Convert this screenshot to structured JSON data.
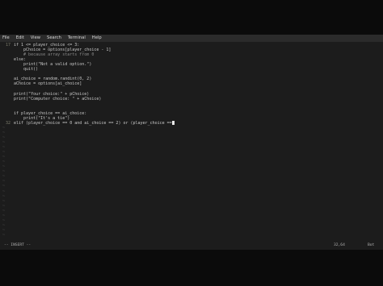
{
  "menubar": {
    "items": [
      "File",
      "Edit",
      "View",
      "Search",
      "Terminal",
      "Help"
    ]
  },
  "editor": {
    "lines": [
      {
        "num": "17",
        "text": "if 1 <= player_choice <= 3:"
      },
      {
        "num": "",
        "text": "    pChoice = options[player_choice - 1]"
      },
      {
        "num": "",
        "text": "    # because array starts from 0"
      },
      {
        "num": "",
        "text": "else:"
      },
      {
        "num": "",
        "text": "    print(\"Not a valid option.\")"
      },
      {
        "num": "",
        "text": "    quit()"
      },
      {
        "num": "",
        "text": ""
      },
      {
        "num": "",
        "text": "ai_choice = random.randint(0, 2)"
      },
      {
        "num": "",
        "text": "aChoice = options[ai_choice]"
      },
      {
        "num": "",
        "text": ""
      },
      {
        "num": "",
        "text": "print(\"Your choice:\" + pChoice)"
      },
      {
        "num": "",
        "text": "print(\"Computer choice: \" + aChoice)"
      },
      {
        "num": "",
        "text": ""
      },
      {
        "num": "",
        "text": ""
      },
      {
        "num": "",
        "text": "if player_choice == ai_choice:"
      },
      {
        "num": "",
        "text": "    print(\"It's a tie\")"
      },
      {
        "num": "32",
        "text": "elif (player_choice == 0 and ai_choice == 2) or (player_choice =="
      }
    ],
    "empty_marker": "~"
  },
  "statusbar": {
    "mode": "-- INSERT --",
    "position": "32,64",
    "scroll": "Bot"
  }
}
